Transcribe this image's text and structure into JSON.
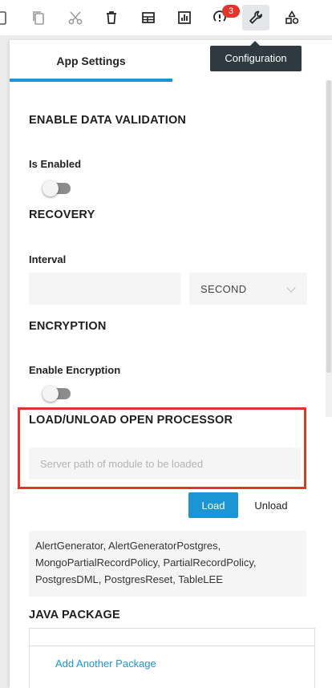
{
  "toolbar": {
    "buttons": [
      {
        "icon": "paste-icon"
      },
      {
        "icon": "copy-icon"
      },
      {
        "icon": "cut-icon"
      },
      {
        "icon": "delete-icon"
      },
      {
        "icon": "table-icon"
      },
      {
        "icon": "chart-icon"
      },
      {
        "icon": "alerts-icon",
        "badge": "3"
      },
      {
        "icon": "wrench-icon",
        "active": true
      },
      {
        "icon": "shapes-icon"
      }
    ],
    "tooltip": "Configuration"
  },
  "tabs": [
    {
      "label": "App Settings",
      "active": true
    }
  ],
  "sections": {
    "validation": {
      "title": "ENABLE DATA VALIDATION",
      "field_label": "Is Enabled",
      "enabled": false
    },
    "recovery": {
      "title": "RECOVERY",
      "field_label": "Interval",
      "interval_value": "",
      "unit_selected": "SECOND"
    },
    "encryption": {
      "title": "ENCRYPTION",
      "field_label": "Enable Encryption",
      "enabled": false
    },
    "open_processor": {
      "title": "LOAD/UNLOAD OPEN PROCESSOR",
      "path_placeholder": "Server path of module to be loaded",
      "load_label": "Load",
      "unload_label": "Unload",
      "loaded_modules": "AlertGenerator, AlertGeneratorPostgres, MongoPartialRecordPolicy, PartialRecordPolicy, PostgresDML, PostgresReset, TableLEE"
    },
    "java_package": {
      "title": "JAVA PACKAGE",
      "add_label": "Add Another Package"
    }
  },
  "colors": {
    "accent": "#1b95d3",
    "highlight": "#e0352b",
    "badge": "#e5352b",
    "tooltip_bg": "#2e3a40"
  }
}
